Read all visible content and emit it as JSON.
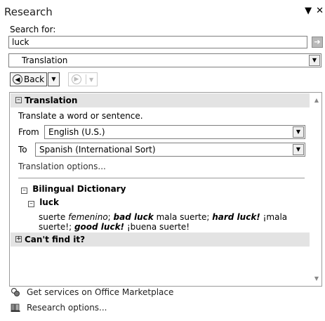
{
  "pane": {
    "title": "Research"
  },
  "search": {
    "label": "Search for:",
    "value": "luck"
  },
  "service": {
    "selected": "Translation"
  },
  "nav": {
    "back_label": "Back"
  },
  "translation": {
    "header": "Translation",
    "prompt": "Translate a word or sentence.",
    "from_label": "From",
    "from_value": "English (U.S.)",
    "to_label": "To",
    "to_value": "Spanish (International Sort)",
    "options_link": "Translation options..."
  },
  "dictionary": {
    "header": "Bilingual Dictionary",
    "headword": "luck",
    "entry": {
      "w1": "suerte",
      "g1": "femenino",
      "s1": "; ",
      "b1": "bad luck",
      "t1": " mala suerte; ",
      "b2": "hard luck!",
      "t2": " ¡mala suerte!;",
      "b3": "good luck!",
      "t3": " ¡buena suerte!"
    }
  },
  "cant_find": {
    "header": "Can't find it?"
  },
  "footer": {
    "marketplace": "Get services on Office Marketplace",
    "options": "Research options..."
  },
  "colors": {
    "section_header_bg": "#e3e3e3",
    "border": "#9b9b9b"
  }
}
